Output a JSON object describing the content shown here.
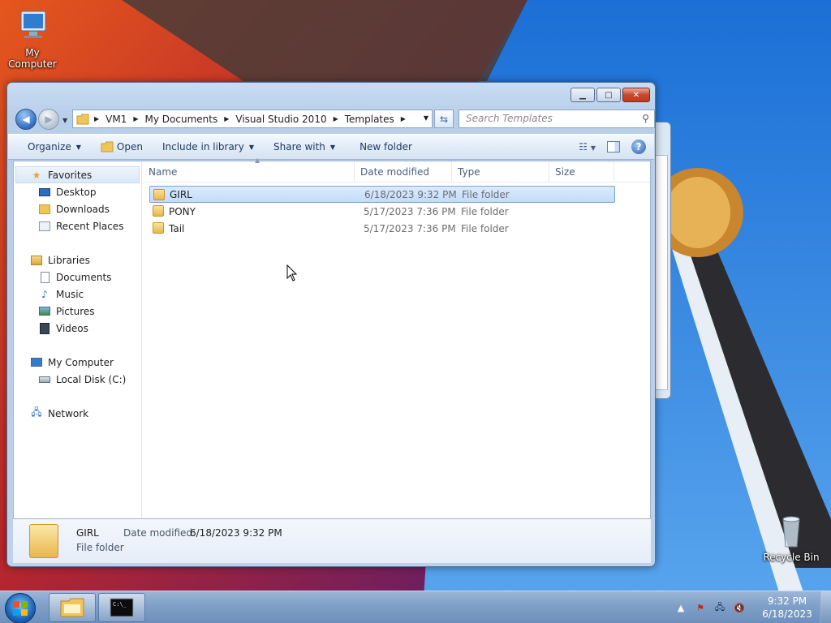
{
  "desktop": {
    "icons": [
      {
        "label": "My Computer",
        "icon": "computer-icon"
      },
      {
        "label": "Recycle Bin",
        "icon": "recycle-bin-icon"
      }
    ]
  },
  "window": {
    "caption_buttons": {
      "minimize": "minimize-icon",
      "maximize": "maximize-icon",
      "close": "close-icon"
    },
    "address": {
      "crumbs": [
        "VM1",
        "My Documents",
        "Visual Studio 2010",
        "Templates"
      ]
    },
    "search": {
      "placeholder": "Search Templates"
    },
    "toolbar": {
      "organize": "Organize",
      "open": "Open",
      "include_in_library": "Include in library",
      "share_with": "Share with",
      "new_folder": "New folder"
    },
    "nav_pane": {
      "favorites": "Favorites",
      "desktop": "Desktop",
      "downloads": "Downloads",
      "recent_places": "Recent Places",
      "libraries": "Libraries",
      "documents": "Documents",
      "music": "Music",
      "pictures": "Pictures",
      "videos": "Videos",
      "my_computer": "My Computer",
      "local_disk": "Local Disk (C:)",
      "network": "Network"
    },
    "columns": {
      "name": "Name",
      "date_modified": "Date modified",
      "type": "Type",
      "size": "Size"
    },
    "files": [
      {
        "name": "GIRL",
        "date": "6/18/2023 9:32 PM",
        "type": "File folder",
        "selected": true
      },
      {
        "name": "PONY",
        "date": "5/17/2023 7:36 PM",
        "type": "File folder",
        "selected": false
      },
      {
        "name": "Tail",
        "date": "5/17/2023 7:36 PM",
        "type": "File folder",
        "selected": false
      }
    ],
    "details": {
      "name": "GIRL",
      "type": "File folder",
      "date_label": "Date modified:",
      "date_value": "6/18/2023 9:32 PM"
    }
  },
  "taskbar": {
    "time": "9:32 PM",
    "date": "6/18/2023"
  },
  "colors": {
    "selection": "#c1dcfc",
    "taskbar": "#7fa0c8",
    "sky": "#2a7ad8"
  }
}
